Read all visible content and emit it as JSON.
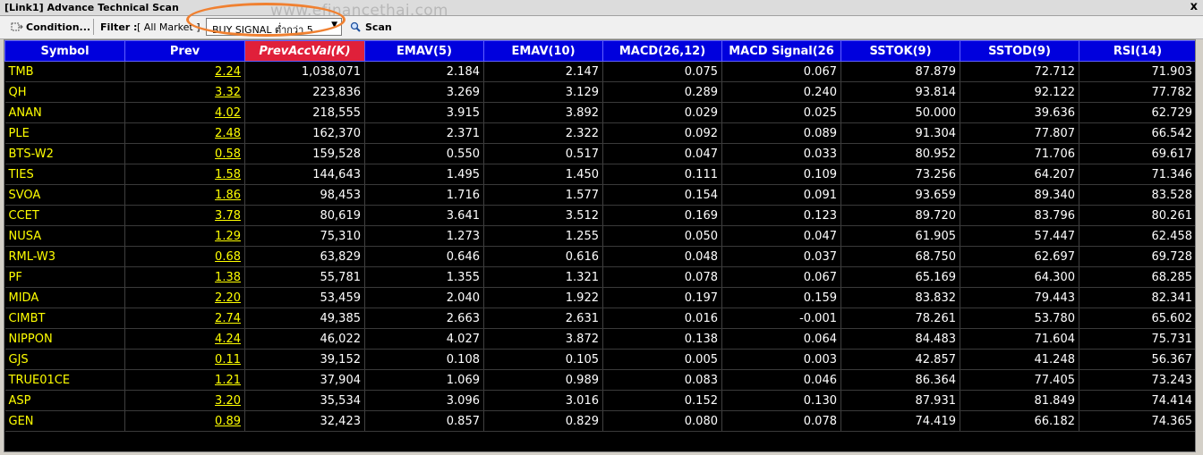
{
  "window": {
    "title": "[Link1] Advance Technical Scan",
    "close_label": "x"
  },
  "watermark": "www.efinancethai.com",
  "toolbar": {
    "condition_label": "Condition...",
    "filter_label": "Filter :",
    "filter_value": "[ All Market ]",
    "signal_select": "BUY SIGNAL ต่ำกว่า 5",
    "scan_label": "Scan"
  },
  "columns": [
    "Symbol",
    "Prev",
    "PrevAccVal(K)",
    "EMAV(5)",
    "EMAV(10)",
    "MACD(26,12)",
    "MACD Signal(26",
    "SSTOK(9)",
    "SSTOD(9)",
    "RSI(14)"
  ],
  "rows": [
    [
      "TMB",
      "2.24",
      "1,038,071",
      "2.184",
      "2.147",
      "0.075",
      "0.067",
      "87.879",
      "72.712",
      "71.903"
    ],
    [
      "QH",
      "3.32",
      "223,836",
      "3.269",
      "3.129",
      "0.289",
      "0.240",
      "93.814",
      "92.122",
      "77.782"
    ],
    [
      "ANAN",
      "4.02",
      "218,555",
      "3.915",
      "3.892",
      "0.029",
      "0.025",
      "50.000",
      "39.636",
      "62.729"
    ],
    [
      "PLE",
      "2.48",
      "162,370",
      "2.371",
      "2.322",
      "0.092",
      "0.089",
      "91.304",
      "77.807",
      "66.542"
    ],
    [
      "BTS-W2",
      "0.58",
      "159,528",
      "0.550",
      "0.517",
      "0.047",
      "0.033",
      "80.952",
      "71.706",
      "69.617"
    ],
    [
      "TIES",
      "1.58",
      "144,643",
      "1.495",
      "1.450",
      "0.111",
      "0.109",
      "73.256",
      "64.207",
      "71.346"
    ],
    [
      "SVOA",
      "1.86",
      "98,453",
      "1.716",
      "1.577",
      "0.154",
      "0.091",
      "93.659",
      "89.340",
      "83.528"
    ],
    [
      "CCET",
      "3.78",
      "80,619",
      "3.641",
      "3.512",
      "0.169",
      "0.123",
      "89.720",
      "83.796",
      "80.261"
    ],
    [
      "NUSA",
      "1.29",
      "75,310",
      "1.273",
      "1.255",
      "0.050",
      "0.047",
      "61.905",
      "57.447",
      "62.458"
    ],
    [
      "RML-W3",
      "0.68",
      "63,829",
      "0.646",
      "0.616",
      "0.048",
      "0.037",
      "68.750",
      "62.697",
      "69.728"
    ],
    [
      "PF",
      "1.38",
      "55,781",
      "1.355",
      "1.321",
      "0.078",
      "0.067",
      "65.169",
      "64.300",
      "68.285"
    ],
    [
      "MIDA",
      "2.20",
      "53,459",
      "2.040",
      "1.922",
      "0.197",
      "0.159",
      "83.832",
      "79.443",
      "82.341"
    ],
    [
      "CIMBT",
      "2.74",
      "49,385",
      "2.663",
      "2.631",
      "0.016",
      "-0.001",
      "78.261",
      "53.780",
      "65.602"
    ],
    [
      "NIPPON",
      "4.24",
      "46,022",
      "4.027",
      "3.872",
      "0.138",
      "0.064",
      "84.483",
      "71.604",
      "75.731"
    ],
    [
      "GJS",
      "0.11",
      "39,152",
      "0.108",
      "0.105",
      "0.005",
      "0.003",
      "42.857",
      "41.248",
      "56.367"
    ],
    [
      "TRUE01CE",
      "1.21",
      "37,904",
      "1.069",
      "0.989",
      "0.083",
      "0.046",
      "86.364",
      "77.405",
      "73.243"
    ],
    [
      "ASP",
      "3.20",
      "35,534",
      "3.096",
      "3.016",
      "0.152",
      "0.130",
      "87.931",
      "81.849",
      "74.414"
    ],
    [
      "GEN",
      "0.89",
      "32,423",
      "0.857",
      "0.829",
      "0.080",
      "0.078",
      "74.419",
      "66.182",
      "74.365"
    ]
  ],
  "colors": {
    "header_bg": "#0000dd",
    "sorted_header_bg": "#e0203a",
    "symbol_text": "#ffff00",
    "highlight_oval": "#f08030"
  }
}
